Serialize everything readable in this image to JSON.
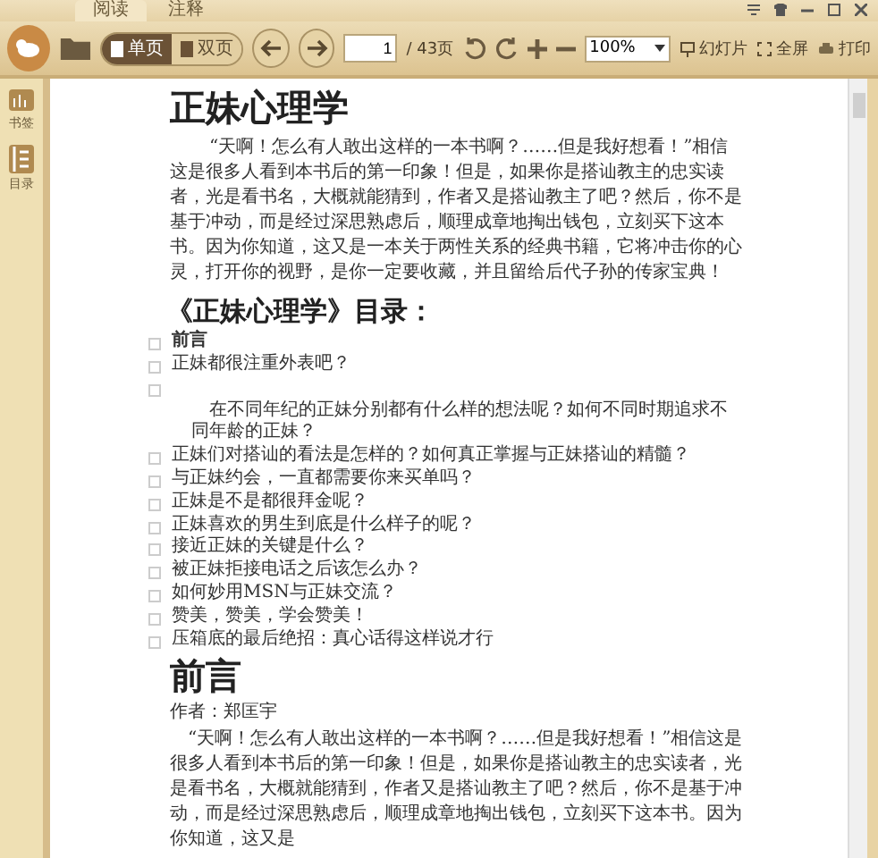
{
  "tabs": [
    {
      "label": "阅读",
      "selected": true
    },
    {
      "label": "注释",
      "selected": false
    }
  ],
  "toolbar": {
    "view_modes": [
      {
        "label": "单页",
        "selected": true
      },
      {
        "label": "双页",
        "selected": false
      }
    ],
    "page_input": "1",
    "page_total": "/ 43页",
    "zoom": "100%",
    "actions": [
      {
        "kind": "slideshow",
        "label": "幻灯片"
      },
      {
        "kind": "fullscreen",
        "label": "全屏"
      },
      {
        "kind": "print",
        "label": "打印"
      }
    ]
  },
  "sidebar": [
    {
      "kind": "bookmark",
      "label": "书签"
    },
    {
      "kind": "toc",
      "label": "目录"
    }
  ],
  "document": {
    "title": "正妹心理学",
    "intro": "“天啊！怎么有人敢出这样的一本书啊？……但是我好想看！”相信这是很多人看到本书后的第一印象！但是，如果你是搭讪教主的忠实读者，光是看书名，大概就能猜到，作者又是搭讪教主了吧？然后，你不是基于冲动，而是经过深思熟虑后，顺理成章地掏出钱包，立刻买下这本书。因为你知道，这又是一本关于两性关系的经典书籍，它将冲击你的心灵，打开你的视野，是你一定要收藏，并且留给后代子孙的传家宝典！",
    "toc_heading": "《正妹心理学》目录：",
    "toc": [
      {
        "kind": "bold",
        "text": "前言"
      },
      {
        "kind": "plain",
        "text": "正妹都很注重外表吧？"
      },
      {
        "kind": "detached",
        "text": "在不同年纪的正妹分别都有什么样的想法呢？如何不同时期追求不同年龄的正妹？"
      },
      {
        "kind": "plain",
        "text": "正妹们对搭讪的看法是怎样的？如何真正掌握与正妹搭讪的精髓？"
      },
      {
        "kind": "plain",
        "text": "与正妹约会，一直都需要你来买单吗？"
      },
      {
        "kind": "plain",
        "text": "正妹是不是都很拜金呢？"
      },
      {
        "kind": "plain",
        "text": "正妹喜欢的男生到底是什么样子的呢？"
      },
      {
        "kind": "plain",
        "text": "接近正妹的关键是什么？"
      },
      {
        "kind": "plain",
        "text": "被正妹拒接电话之后该怎么办？"
      },
      {
        "kind": "plain",
        "text": "如何妙用MSN与正妹交流？"
      },
      {
        "kind": "plain",
        "text": "赞美，赞美，学会赞美！"
      },
      {
        "kind": "plain",
        "text": "压箱底的最后绝招：真心话得这样说才行"
      }
    ],
    "section_title": "前言",
    "author": "作者：郑匡宇",
    "section_text": "“天啊！怎么有人敢出这样的一本书啊？……但是我好想看！”相信这是很多人看到本书后的第一印象！但是，如果你是搭讪教主的忠实读者，光是看书名，大概就能猜到，作者又是搭讪教主了吧？然后，你不是基于冲动，而是经过深思熟虑后，顺理成章地掏出钱包，立刻买下这本书。因为你知道，这又是"
  }
}
